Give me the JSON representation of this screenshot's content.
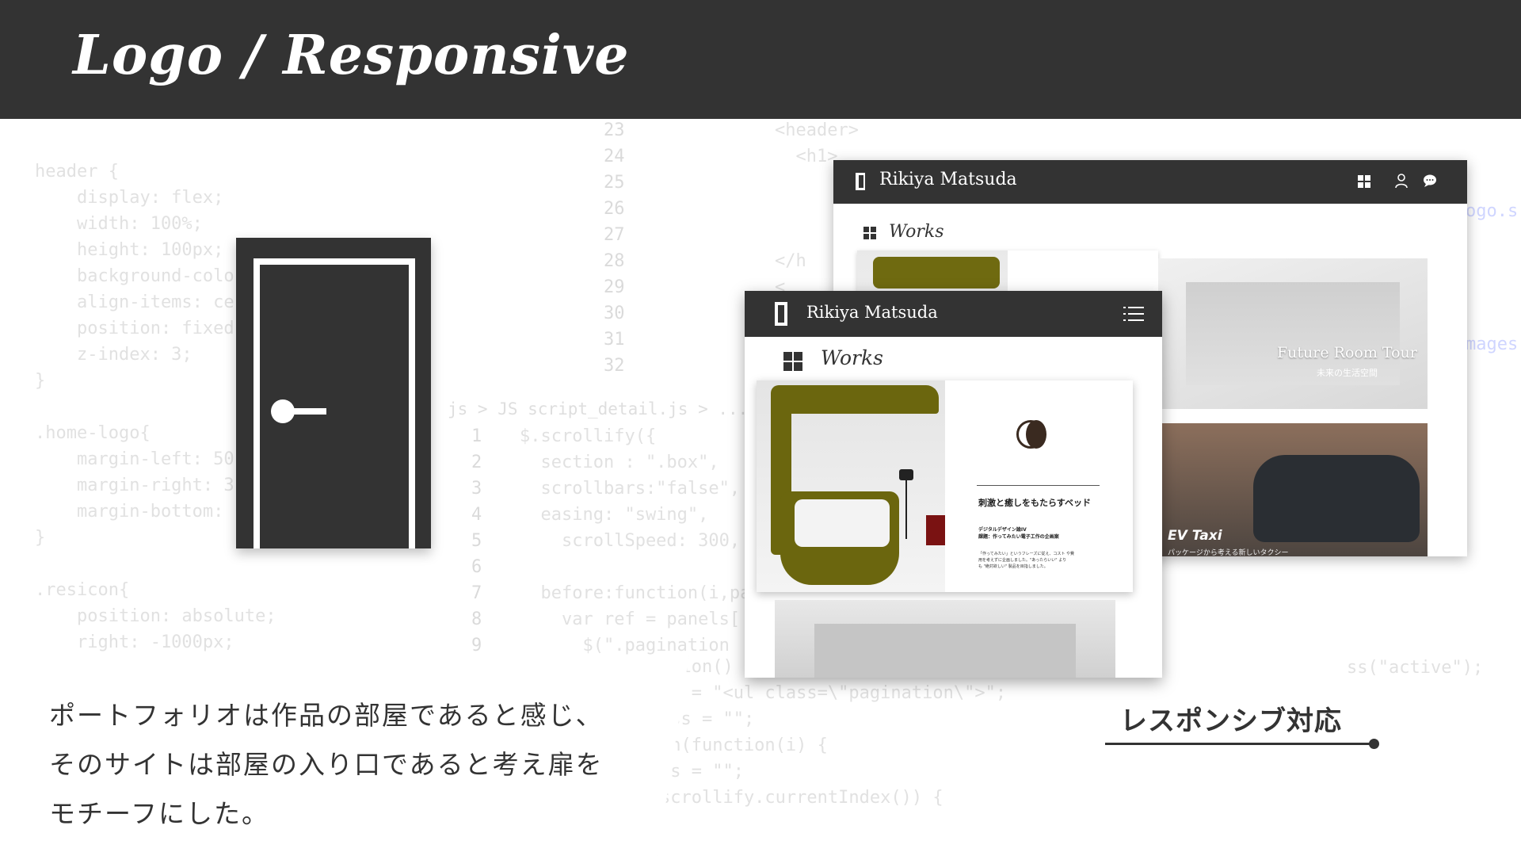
{
  "header": {
    "title": "Logo / Responsive"
  },
  "code_background": {
    "left_css": "header {\n    display: flex;\n    width: 100%;\n    height: 100px;\n    background-colo\n    align-items: ce\n    position: fixed\n    z-index: 3;\n}\n\n.home-logo{\n    margin-left: 50\n    margin-right: 3\n    margin-bottom: \n}\n\n.resicon{\n    position: absolute;\n    right: -1000px;",
    "mid_line_numbers": "23\n24\n25\n26\n27\n28\n29\n30\n31\n32",
    "mid_html": "<header>\n  <h1>\n\n\n\n</h\n<\n",
    "lower_breadcrumb": "js > JS script_detail.js > ...",
    "lower_line_numbers": "1\n2\n3\n4\n5\n6\n7\n8\n9",
    "lower_js": "$.scrollify({\n  section : \".box\",\n  scrollbars:\"false\",\n  easing: \"swing\",\n    scrollSpeed: 300,\n\n  before:function(i,pa\n    var ref = panels[\n      $(\".pagination \n        tion\"",
    "bottom_js": ":function() {\nnation = \"<ul class=\\\"pagination\\\">\";\nveClass = \"\";\n).each(function(i) {\neClass = \"\";\n==$.scrollify.currentIndex()) {",
    "right_js": "ss(\"active\");",
    "right_top": "ogo.s",
    "right_top2": "mages"
  },
  "logo": {
    "icon": "door-icon"
  },
  "quote": {
    "line1": "ポートフォリオは作品の部屋であると感じ、",
    "line2": "そのサイトは部屋の入り口であると考え扉を",
    "line3": "モチーフにした。"
  },
  "responsive": {
    "label": "レスポンシブ対応"
  },
  "desktop_mockup": {
    "brand": "Rikiya Matsuda",
    "nav_icons": [
      "grid-icon",
      "user-icon",
      "chat-icon"
    ],
    "section_title": "Works",
    "cards": [
      {
        "title": "Future Room Tour",
        "subtitle": "未来の生活空間"
      },
      {
        "title": "EV Taxi",
        "subtitle": "パッケージから考える新しいタクシー"
      }
    ]
  },
  "tablet_mockup": {
    "brand": "Rikiya Matsuda",
    "menu_icon": "list-icon",
    "section_title": "Works",
    "card": {
      "title": "刺激と癒しをもたらすベッド",
      "meta": "デジタルデザイン論IV\n課題：作ってみたい電子工作の企画案",
      "description": "「作ってみたい」というフレーズに従え、コスト や費\n用を考えずに企画しました。\"あったらいい\" より\nも \"絶対欲しい\" 製品を目指しました。"
    }
  },
  "colors": {
    "dark": "#333333",
    "white": "#ffffff",
    "olive": "#6b660e",
    "accent_red": "#7a1212"
  }
}
